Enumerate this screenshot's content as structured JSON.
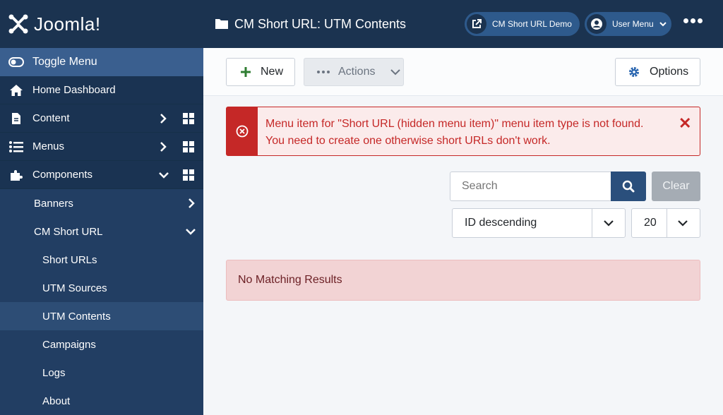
{
  "brand": {
    "name": "Joomla!"
  },
  "sidebar": {
    "toggle_label": "Toggle Menu",
    "items": [
      {
        "label": "Home Dashboard",
        "icon": "home-icon"
      },
      {
        "label": "Content",
        "icon": "file-icon"
      },
      {
        "label": "Menus",
        "icon": "list-icon"
      },
      {
        "label": "Components",
        "icon": "puzzle-icon"
      }
    ],
    "sub_items": [
      {
        "label": "Banners"
      },
      {
        "label": "CM Short URL"
      }
    ],
    "cm_items": [
      {
        "label": "Short URLs"
      },
      {
        "label": "UTM Sources"
      },
      {
        "label": "UTM Contents",
        "active": true
      },
      {
        "label": "Campaigns"
      },
      {
        "label": "Logs"
      },
      {
        "label": "About"
      }
    ]
  },
  "header": {
    "title": "CM Short URL: UTM Contents",
    "site_link": "CM Short URL Demo",
    "user_menu": "User Menu"
  },
  "toolbar": {
    "new_label": "New",
    "actions_label": "Actions",
    "options_label": "Options"
  },
  "alert": {
    "line1": "Menu item for \"Short URL (hidden menu item)\" menu item type is not found.",
    "line2": "You need to create one otherwise short URLs don't work."
  },
  "filters": {
    "search_placeholder": "Search",
    "clear_label": "Clear",
    "ordering": "ID descending",
    "limit": "20"
  },
  "results": {
    "empty_message": "No Matching Results"
  },
  "colors": {
    "sidebar": "#1f3a5f",
    "header": "#1b3350",
    "danger": "#c52827",
    "primary": "#2a4f7c"
  }
}
